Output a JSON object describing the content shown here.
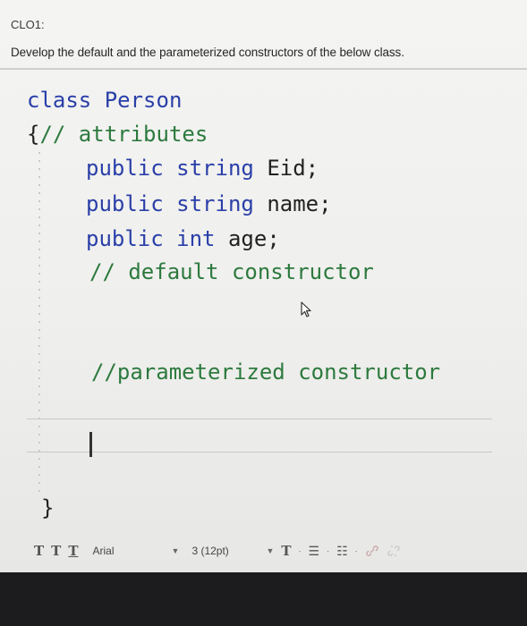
{
  "question": {
    "label": "CLO1:",
    "prompt": "Develop the default and the parameterized constructors of the below class."
  },
  "code": {
    "line1_kw": "class",
    "line1_name": "Person",
    "line2_brace": "{",
    "line2_comment": "// attributes",
    "line3_kw1": "public",
    "line3_kw2": "string",
    "line3_rest": "Eid;",
    "line4_kw1": "public",
    "line4_kw2": "string",
    "line4_rest": "name;",
    "line5_kw1": "public",
    "line5_kw2": "int",
    "line5_rest": "age;",
    "line6_comment": "// default constructor",
    "line7_comment": "//parameterized constructor",
    "close_brace": "}"
  },
  "toolbar": {
    "t1": "T",
    "t2": "T",
    "t3": "T",
    "font": "Arial",
    "size": "3 (12pt)",
    "text_color": "T",
    "arrow": "▼",
    "bullet_list_icon": "☰",
    "numbered_list_icon": "☷",
    "dash": "·"
  },
  "colors": {
    "keyword": "#2a3fa8",
    "comment": "#2d7a3e"
  }
}
